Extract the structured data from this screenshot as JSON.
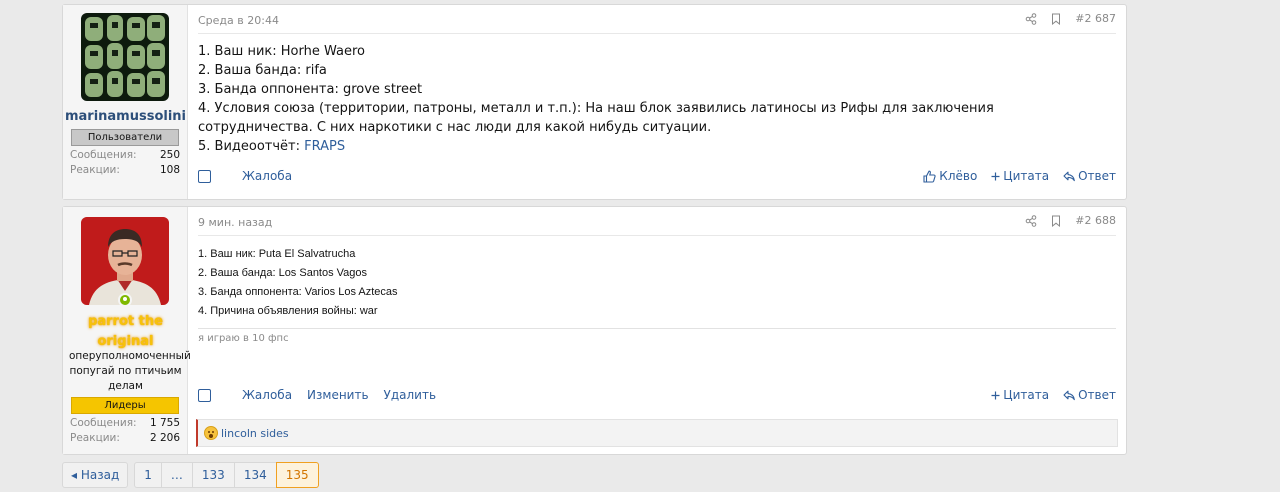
{
  "posts": [
    {
      "username": "marinamussolini",
      "badge": "Пользователи",
      "stats": [
        {
          "label": "Сообщения:",
          "value": "250"
        },
        {
          "label": "Реакции:",
          "value": "108"
        }
      ],
      "date": "Среда в 20:44",
      "number": "#2 687",
      "lines": [
        "1. Ваш ник: Horhe Waero",
        "2. Ваша банда: rifa",
        "3. Банда оппонента: grove street",
        "4. Условия союза (территории, патроны, металл и т.п.): На наш блок заявились латиносы из Рифы для заключения сотрудничества. С них наркотики с нас люди для какой нибудь ситуации."
      ],
      "video_label": "5. Видеоотчёт: ",
      "video_link": "FRAPS",
      "actions": {
        "report": "Жалоба",
        "like": "Клёво",
        "quote": "Цитата",
        "reply": "Ответ"
      }
    },
    {
      "username": "parrot the original",
      "user_title": "оперуполномоченный попугай по птичьим делам",
      "badge": "Лидеры",
      "stats": [
        {
          "label": "Сообщения:",
          "value": "1 755"
        },
        {
          "label": "Реакции:",
          "value": "2 206"
        }
      ],
      "date": "9 мин. назад",
      "number": "#2 688",
      "lines": [
        "1. Ваш ник: Puta El Salvatrucha",
        "2. Ваша банда: Los Santos Vagos",
        "3. Банда оппонента: Varios Los Aztecas",
        "4. Причина объявления войны: war"
      ],
      "signature": "я играю в 10 фпс",
      "actions": {
        "report": "Жалоба",
        "edit": "Изменить",
        "delete": "Удалить",
        "quote": "Цитата",
        "reply": "Ответ"
      },
      "reaction_user": "lincoln sides"
    }
  ],
  "pagination": {
    "back": "Назад",
    "pages": [
      "1",
      "…",
      "133",
      "134",
      "135"
    ],
    "current": "135"
  },
  "colors": {
    "link": "#2f5e9b",
    "leader_gold": "#f7c20a",
    "current_page": "#d27500"
  }
}
